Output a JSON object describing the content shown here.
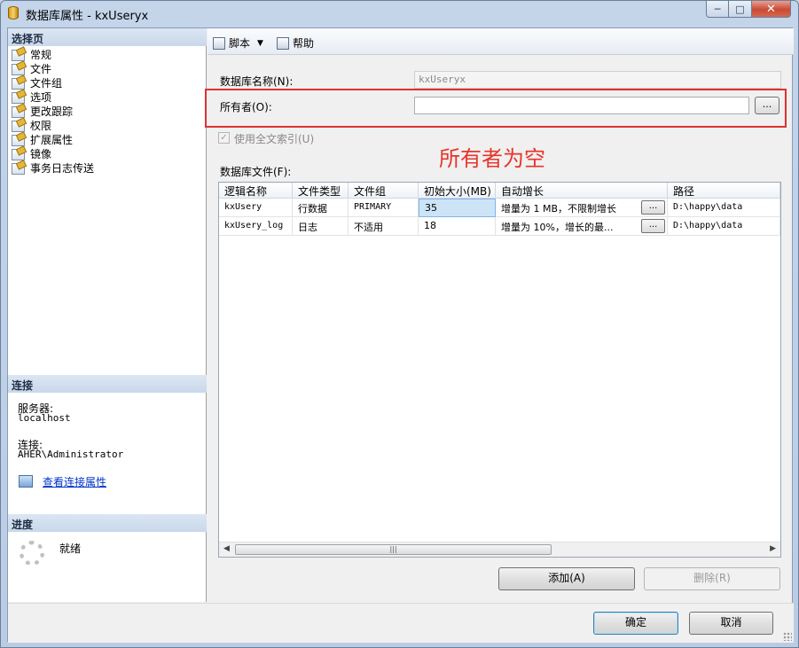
{
  "window": {
    "title": "数据库属性 - kxUseryx"
  },
  "left": {
    "select_page_header": "选择页",
    "nav_items": [
      "常规",
      "文件",
      "文件组",
      "选项",
      "更改跟踪",
      "权限",
      "扩展属性",
      "镜像",
      "事务日志传送"
    ],
    "connection_header": "连接",
    "server_label": "服务器:",
    "server_value": "localhost",
    "connection_label": "连接:",
    "connection_value": "AHER\\Administrator",
    "view_conn_link": "查看连接属性",
    "progress_header": "进度",
    "progress_status": "就绪"
  },
  "toolbar": {
    "script_label": "脚本",
    "help_label": "帮助"
  },
  "form": {
    "dbname_label": "数据库名称(N):",
    "dbname_value": "kxUseryx",
    "owner_label": "所有者(O):",
    "owner_value": "",
    "owner_browse": "...",
    "fulltext_label": "使用全文索引(U)",
    "annotation": "所有者为空",
    "files_label": "数据库文件(F):"
  },
  "grid": {
    "columns": [
      "逻辑名称",
      "文件类型",
      "文件组",
      "初始大小(MB)",
      "自动增长",
      "路径"
    ],
    "rows": [
      {
        "logical": "kxUsery",
        "type": "行数据",
        "group": "PRIMARY",
        "size": "35",
        "growth": "增量为 1 MB，不限制增长",
        "path": "D:\\happy\\data"
      },
      {
        "logical": "kxUsery_log",
        "type": "日志",
        "group": "不适用",
        "size": "18",
        "growth": "增量为 10%，增长的最...",
        "path": "D:\\happy\\data"
      }
    ],
    "ellipsis": "...",
    "scroll_thumb_grip": "|||"
  },
  "buttons": {
    "add": "添加(A)",
    "remove": "删除(R)",
    "ok": "确定",
    "cancel": "取消"
  }
}
